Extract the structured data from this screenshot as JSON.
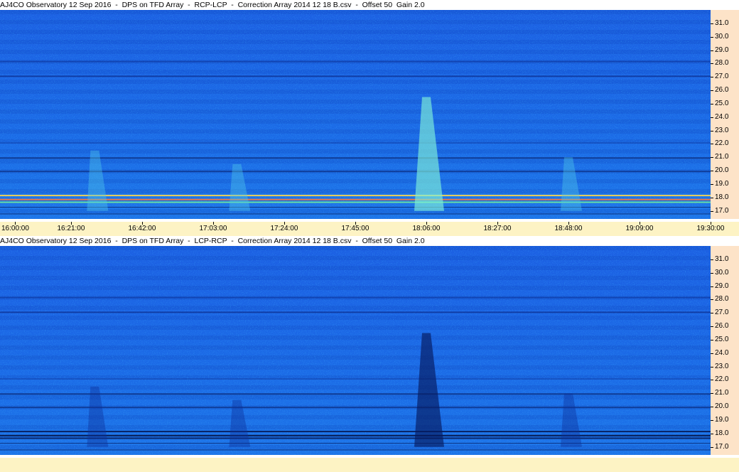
{
  "panels": [
    {
      "title": "AJ4CO Observatory 12 Sep 2016  -  DPS on TFD Array  -  RCP-LCP  -  Correction Array 2014 12 18 B.csv  -  Offset 50  Gain 2.0",
      "mode": "RCP-LCP"
    },
    {
      "title": "AJ4CO Observatory 12 Sep 2016  -  DPS on TFD Array  -  LCP-RCP  -  Correction Array 2014 12 18 B.csv  -  Offset 50  Gain 2.0",
      "mode": "LCP-RCP"
    }
  ],
  "colors": {
    "background_blue": "#1a5fe0",
    "axis_right": "#fde3c8",
    "axis_bottom": "#fdf3c4"
  },
  "chart_data": [
    {
      "type": "heatmap",
      "title": "AJ4CO Observatory 12 Sep 2016  -  DPS on TFD Array  -  RCP-LCP  -  Correction Array 2014 12 18 B.csv  -  Offset 50  Gain 2.0",
      "x_tick_labels": [
        "16:00:00",
        "16:21:00",
        "16:42:00",
        "17:03:00",
        "17:24:00",
        "17:45:00",
        "18:06:00",
        "18:27:00",
        "18:48:00",
        "19:09:00",
        "19:30:00"
      ],
      "y_tick_labels": [
        "17.0",
        "18.0",
        "19.0",
        "20.0",
        "21.0",
        "22.0",
        "23.0",
        "24.0",
        "25.0",
        "26.0",
        "27.0",
        "28.0",
        "29.0",
        "30.0",
        "31.0"
      ],
      "ylim": [
        16.4,
        32.0
      ],
      "xlim": [
        "16:00:00",
        "19:30:00"
      ],
      "emission_features": [
        {
          "time": "16:28:00",
          "freq_low": 17.0,
          "freq_high": 21.5,
          "strength": "weak"
        },
        {
          "time": "17:10:00",
          "freq_low": 17.0,
          "freq_high": 20.5,
          "strength": "weak"
        },
        {
          "time": "18:06:00",
          "freq_low": 17.0,
          "freq_high": 25.5,
          "strength": "strong"
        },
        {
          "time": "18:48:00",
          "freq_low": 17.0,
          "freq_high": 21.0,
          "strength": "weak"
        }
      ]
    },
    {
      "type": "heatmap",
      "title": "AJ4CO Observatory 12 Sep 2016  -  DPS on TFD Array  -  LCP-RCP  -  Correction Array 2014 12 18 B.csv  -  Offset 50  Gain 2.0",
      "x_tick_labels": [],
      "y_tick_labels": [
        "17.0",
        "18.0",
        "19.0",
        "20.0",
        "21.0",
        "22.0",
        "23.0",
        "24.0",
        "25.0",
        "26.0",
        "27.0",
        "28.0",
        "29.0",
        "30.0",
        "31.0"
      ],
      "ylim": [
        16.4,
        32.0
      ],
      "emission_features": [
        {
          "time": "16:28:00",
          "freq_low": 17.0,
          "freq_high": 21.5,
          "strength": "weak"
        },
        {
          "time": "17:10:00",
          "freq_low": 17.0,
          "freq_high": 20.5,
          "strength": "weak"
        },
        {
          "time": "18:06:00",
          "freq_low": 17.0,
          "freq_high": 25.5,
          "strength": "strong"
        },
        {
          "time": "18:48:00",
          "freq_low": 17.0,
          "freq_high": 21.0,
          "strength": "weak"
        }
      ]
    }
  ]
}
